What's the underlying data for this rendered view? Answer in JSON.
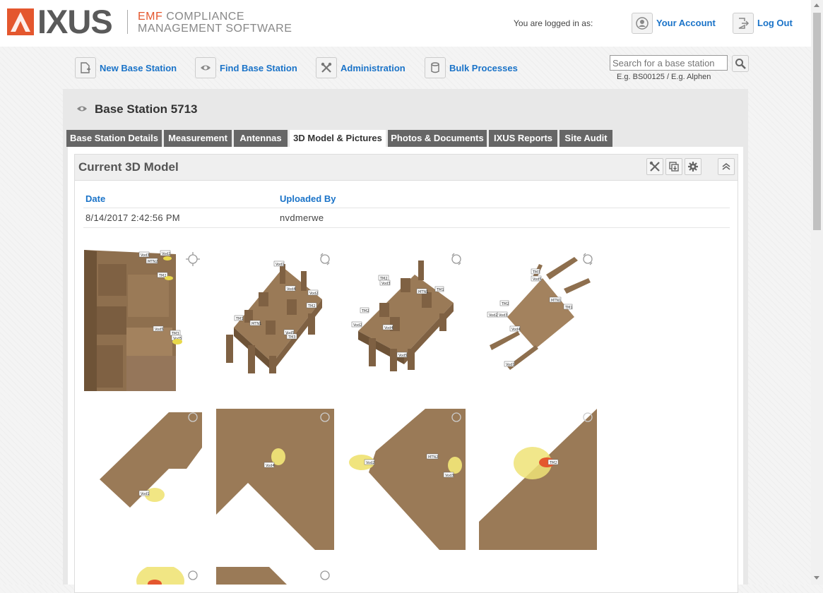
{
  "brand": {
    "name": "IXUS",
    "tagline_accent": "EMF",
    "tagline_line1": "COMPLIANCE",
    "tagline_line2": "MANAGEMENT SOFTWARE",
    "accent_color": "#e4572e"
  },
  "user": {
    "logged_in_text": "You are logged in as:",
    "account_label": "Your Account",
    "logout_label": "Log Out"
  },
  "nav": {
    "items": [
      {
        "label": "New Base Station",
        "icon": "new-document-icon"
      },
      {
        "label": "Find Base Station",
        "icon": "eye-icon"
      },
      {
        "label": "Administration",
        "icon": "tools-icon"
      },
      {
        "label": "Bulk Processes",
        "icon": "database-icon"
      }
    ]
  },
  "search": {
    "placeholder": "Search for a base station",
    "hint": "E.g. BS00125 / E.g. Alphen"
  },
  "page": {
    "title": "Base Station 5713"
  },
  "tabs": [
    {
      "label": "Base Station Details",
      "active": false
    },
    {
      "label": "Measurement",
      "active": false
    },
    {
      "label": "Antennas",
      "active": false
    },
    {
      "label": "3D Model & Pictures",
      "active": true
    },
    {
      "label": "Photos & Documents",
      "active": false
    },
    {
      "label": "IXUS Reports",
      "active": false
    },
    {
      "label": "Site Audit",
      "active": false
    }
  ],
  "model_panel": {
    "title": "Current 3D Model",
    "columns": {
      "date": "Date",
      "uploaded_by": "Uploaded By"
    },
    "row": {
      "date": "8/14/2017 2:42:56 PM",
      "uploaded_by": "nvdmerwe"
    }
  },
  "labels": {
    "vod1": "Vod1",
    "vod2": "Vod2",
    "vod3": "Vod3",
    "vod4": "Vod4",
    "vod5": "Vod5",
    "mtn1": "MTN1",
    "mtn2": "MTN2",
    "tm1": "TM1",
    "tm2": "TM2",
    "tm3": "TM3"
  }
}
